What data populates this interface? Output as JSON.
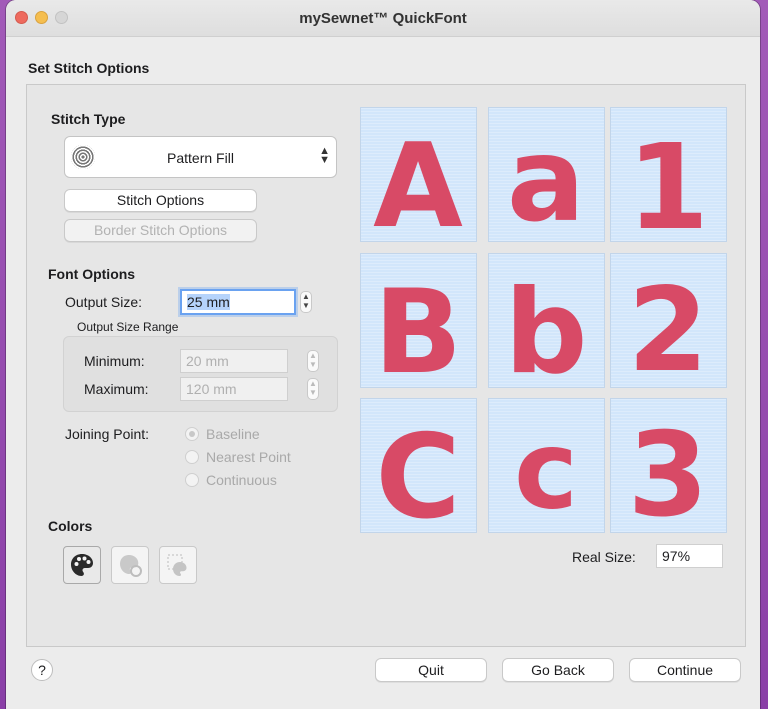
{
  "window": {
    "title": "mySewnet™ QuickFont"
  },
  "page": {
    "section_title": "Set Stitch Options"
  },
  "stitch_type": {
    "heading": "Stitch Type",
    "selected": "Pattern Fill",
    "stitch_options_label": "Stitch Options",
    "border_stitch_options_label": "Border Stitch Options"
  },
  "font_options": {
    "heading": "Font Options",
    "output_size_label": "Output Size:",
    "output_size_value": "25 mm",
    "range_label": "Output Size Range",
    "minimum_label": "Minimum:",
    "minimum_value": "20 mm",
    "maximum_label": "Maximum:",
    "maximum_value": "120 mm",
    "joining_point_label": "Joining Point:",
    "joining_options": [
      "Baseline",
      "Nearest Point",
      "Continuous"
    ],
    "joining_selected": "Baseline"
  },
  "colors": {
    "heading": "Colors"
  },
  "preview": {
    "glyphs": [
      "A",
      "a",
      "1",
      "B",
      "b",
      "2",
      "C",
      "c",
      "3"
    ],
    "thread_color": "#d84a66",
    "background_color": "#d2e6fb",
    "real_size_label": "Real Size:",
    "real_size_value": "97%"
  },
  "footer": {
    "help_label": "?",
    "quit_label": "Quit",
    "go_back_label": "Go Back",
    "continue_label": "Continue"
  }
}
